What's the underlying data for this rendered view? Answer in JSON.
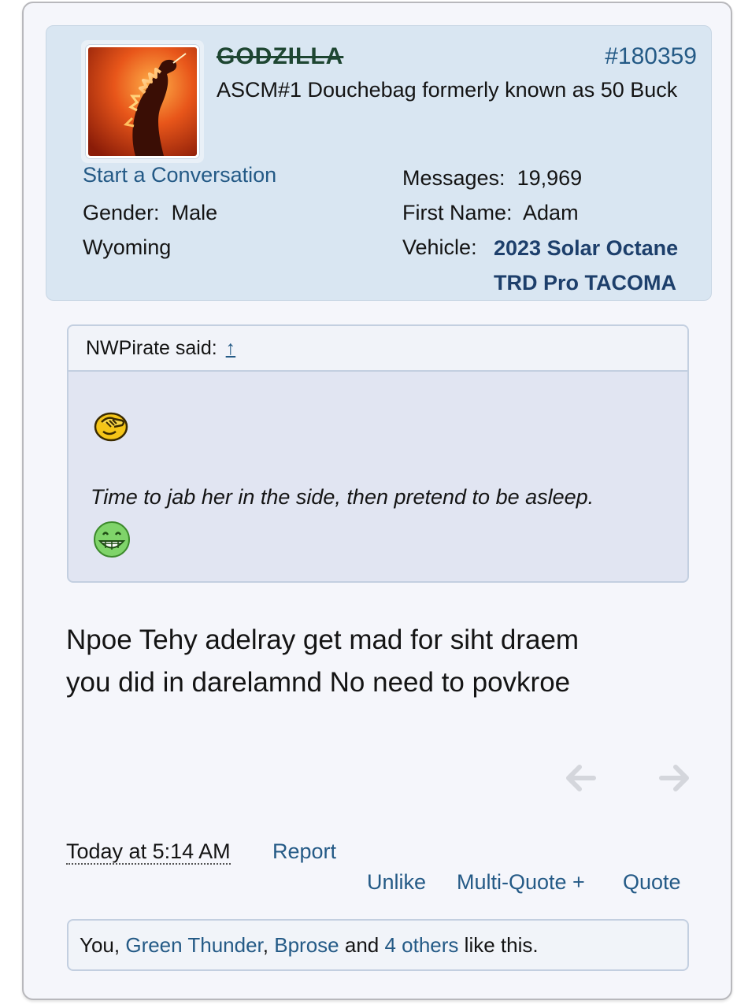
{
  "post": {
    "username": "GODZILLA",
    "post_number": "#180359",
    "user_title": "ASCM#1 Douchebag formerly known as 50 Buck",
    "start_conversation": "Start a Conversation",
    "gender_label": "Gender:",
    "gender_value": "Male",
    "location": "Wyoming",
    "messages_label": "Messages:",
    "messages_value": "19,969",
    "first_name_label": "First Name:",
    "first_name_value": "Adam",
    "vehicle_label": "Vehicle:",
    "vehicle_line1": "2023 Solar Octane",
    "vehicle_line2": "TRD Pro TACOMA"
  },
  "quote": {
    "author": "NWPirate said:",
    "jump_symbol": "↑",
    "text": "Time to jab her in the side, then pretend to be asleep.",
    "emoji_1": "facepalm-smiley",
    "emoji_2": "grin-smiley"
  },
  "message": {
    "line1": "Npoe Tehy adelray get mad for siht draem",
    "line2": "you did in darelamnd No need to povkroe"
  },
  "footer": {
    "timestamp": "Today at 5:14 AM",
    "report": "Report",
    "unlike": "Unlike",
    "multi_quote": "Multi-Quote +",
    "quote": "Quote"
  },
  "likes": {
    "you": "You,",
    "user1": "Green Thunder",
    "sep": ",",
    "user2": "Bprose",
    "and": "and",
    "others": "4 others",
    "suffix": "like this."
  },
  "colors": {
    "link": "#245a86",
    "userbox_bg": "#d9e6f2",
    "quote_bg": "#e1e5f2",
    "username": "#1e4632"
  }
}
